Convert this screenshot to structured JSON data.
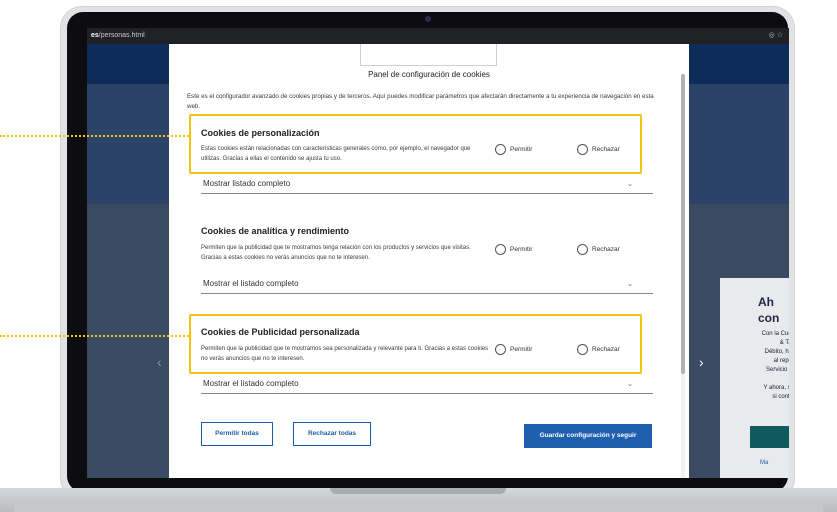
{
  "browser": {
    "url_host": "es",
    "url_path": "/personas.html"
  },
  "modal": {
    "title": "Panel de configuración de cookies",
    "intro": "Este es el configurador avanzado de cookies propias y de terceros. Aquí puedes modificar parámetros que afectarán directamente a tu experiencia de navegación en esta web.",
    "sections": [
      {
        "title": "Cookies de personalización",
        "description": "Estas cookies están relacionadas con características generales como, por ejemplo, el navegador que utilizas. Gracias a ellas el contenido se ajusta tu uso.",
        "allow_label": "Permitir",
        "reject_label": "Rechazar",
        "expander_label": "Mostrar listado completo"
      },
      {
        "title": "Cookies de analítica y rendimiento",
        "description": "Permiten que la publicidad que te mostramos tenga relación con los productos y servicios que visitas. Gracias a estas cookies no verás anuncios que no te interesen.",
        "allow_label": "Permitir",
        "reject_label": "Rechazar",
        "expander_label": "Mostrar el listado completo"
      },
      {
        "title": "Cookies de Publicidad personalizada",
        "description": "Permiten que la publicidad que te mostramos sea personalizada y relevante para ti. Gracias a estas cookies no verás anuncios que no te interesen.",
        "allow_label": "Permitir",
        "reject_label": "Rechazar",
        "expander_label": "Mostrar el listado completo"
      }
    ],
    "buttons": {
      "allow_all": "Permitir todas",
      "reject_all": "Rechazar todas",
      "save": "Guardar configuración y seguir"
    }
  },
  "background_card": {
    "title": "Ah\ncon",
    "text": "Con la Cuenta\n& Tarjet\nDébito, hasta\nal reposta\nServicio Rep\n\nY ahora, sin c\nsi contrata",
    "link": "Ma"
  },
  "colors": {
    "highlight": "#f2c40b",
    "primary_button": "#1e5fb0",
    "link_blue": "#1d5fa8"
  }
}
